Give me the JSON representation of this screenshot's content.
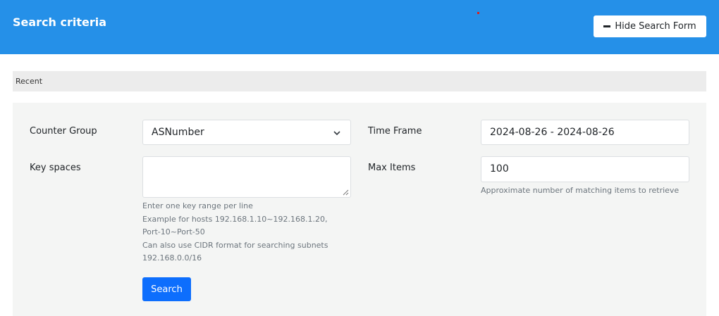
{
  "header": {
    "title": "Search criteria",
    "hide_button_label": "Hide Search Form"
  },
  "recent": {
    "label": "Recent"
  },
  "form": {
    "counter_group": {
      "label": "Counter Group",
      "selected": "ASNumber"
    },
    "time_frame": {
      "label": "Time Frame",
      "value": "2024-08-26 - 2024-08-26"
    },
    "key_spaces": {
      "label": "Key spaces",
      "value": "",
      "help_lines": [
        "Enter one key range per line",
        "Example for hosts 192.168.1.10~192.168.1.20,",
        "Port-10~Port-50",
        "Can also use CIDR format for searching subnets",
        "192.168.0.0/16"
      ]
    },
    "max_items": {
      "label": "Max Items",
      "value": "100",
      "help": "Approximate number of matching items to retrieve"
    },
    "search_button_label": "Search"
  },
  "colors": {
    "header_bg": "#2590e8",
    "primary_button": "#0d6efd",
    "panel_bg": "#f4f5f4"
  }
}
